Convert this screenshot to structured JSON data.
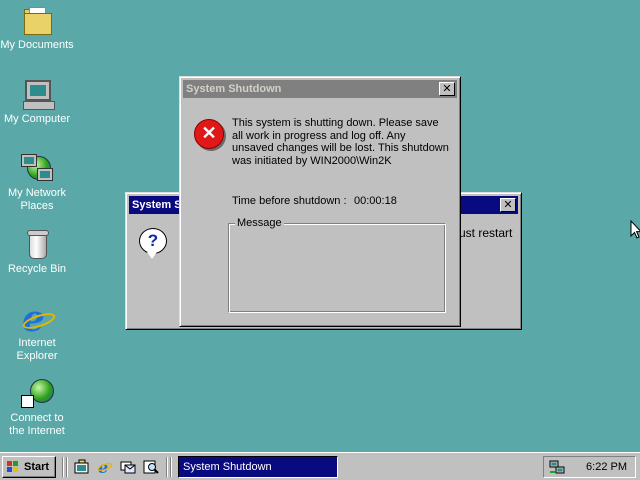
{
  "desktop": {
    "background": "#5aa9a8",
    "icons": [
      {
        "label": "My Documents",
        "icon": "folder-icon"
      },
      {
        "label": "My Computer",
        "icon": "computer-icon"
      },
      {
        "label": "My Network\nPlaces",
        "icon": "network-icon"
      },
      {
        "label": "Recycle Bin",
        "icon": "recycle-bin-icon"
      },
      {
        "label": "Internet\nExplorer",
        "icon": "ie-icon"
      },
      {
        "label": "Connect to\nthe Internet",
        "icon": "connect-icon"
      }
    ]
  },
  "shutdown_dialog": {
    "title": "System Shutdown",
    "message": "This system is shutting down. Please save all work in progress and log off. Any unsaved changes will be lost. This shutdown was initiated by WIN2000\\Win2K",
    "time_label": "Time before shutdown :",
    "time_value": "00:00:18",
    "message_group_label": "Message",
    "close_glyph": "✕"
  },
  "background_dialog": {
    "title": "System S",
    "partial_text": "ust restart",
    "close_glyph": "✕",
    "icon": "question-icon"
  },
  "taskbar": {
    "start_label": "Start",
    "quick_launch": [
      "show-desktop-icon",
      "ie-quicklaunch-icon",
      "outlook-quicklaunch-icon",
      "search-quicklaunch-icon"
    ],
    "task_button_label": "System Shutdown",
    "clock": "6:22 PM",
    "tray_icon": "network-tray-icon"
  },
  "colors": {
    "titlebar_active": "#0a0a80",
    "titlebar_inactive": "#808080",
    "window_face": "#c0c0c0",
    "error_red": "#e01818"
  }
}
